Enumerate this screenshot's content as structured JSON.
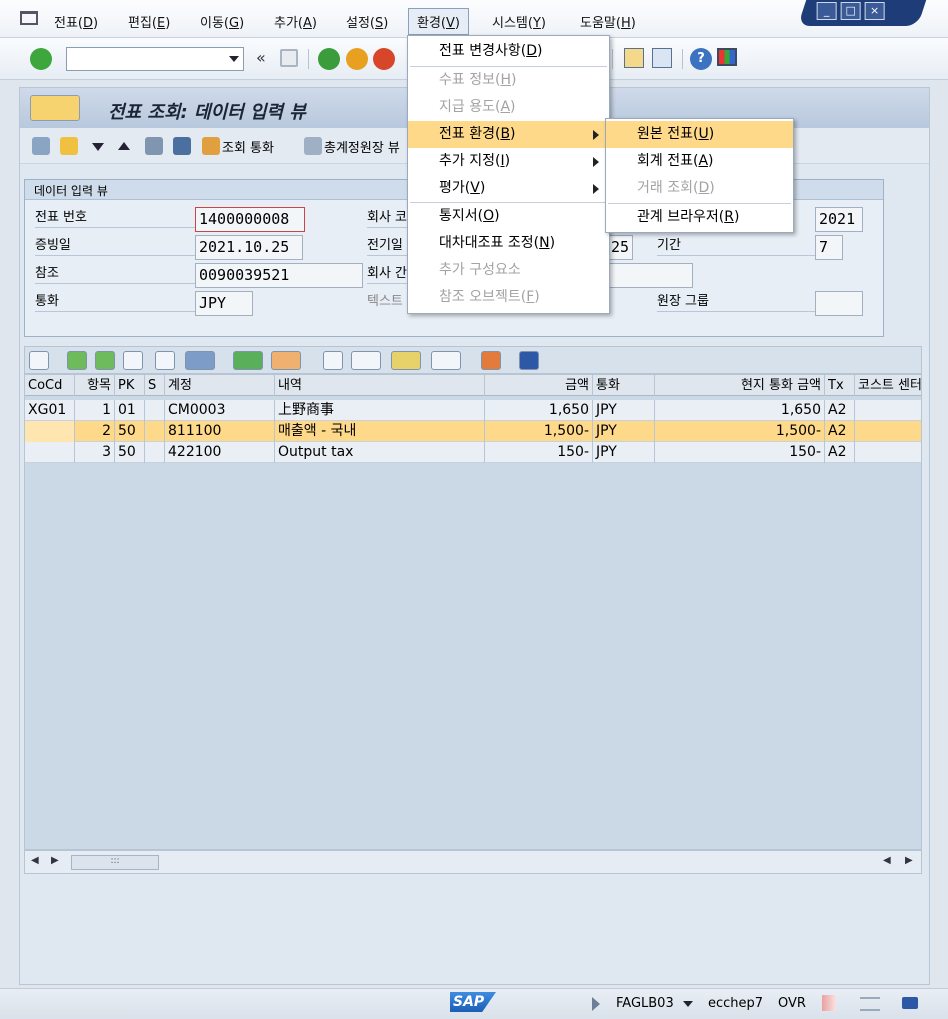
{
  "menubar": {
    "items": [
      {
        "label": "전표(",
        "key": "D",
        "end": ")"
      },
      {
        "label": "편집(",
        "key": "E",
        "end": ")"
      },
      {
        "label": "이동(",
        "key": "G",
        "end": ")"
      },
      {
        "label": "추가(",
        "key": "A",
        "end": ")"
      },
      {
        "label": "설정(",
        "key": "S",
        "end": ")"
      },
      {
        "label": "환경(",
        "key": "V",
        "end": ")"
      },
      {
        "label": "시스템(",
        "key": "Y",
        "end": ")"
      },
      {
        "label": "도움말(",
        "key": "H",
        "end": ")"
      }
    ]
  },
  "toolbar": {
    "command_value": "",
    "back_glyph": "«"
  },
  "screen": {
    "title": "전표 조회: 데이터 입력 뷰",
    "app_toolbar": {
      "display_currency": "조회 통화",
      "general_ledger": "총계정원장 뷰"
    }
  },
  "header": {
    "group_title": "데이터 입력 뷰",
    "doc_number_label": "전표 번호",
    "doc_number": "1400000008",
    "doc_date_label": "증빙일",
    "doc_date": "2021.10.25",
    "reference_label": "참조",
    "reference": "0090039521",
    "currency_label": "통화",
    "currency": "JPY",
    "company_label": "회사 코",
    "posting_date_label": "전기일",
    "posting_date_tail": "25",
    "intercompany_label": "회사 간",
    "text_label": "텍스트",
    "fiscal_year": "2021",
    "period_label": "기간",
    "period": "7",
    "ledger_group_label": "원장 그룹",
    "ledger_group": ""
  },
  "table": {
    "columns": [
      "CoCd",
      "항목",
      "PK",
      "S",
      "계정",
      "내역",
      "금액",
      "통화",
      "현지 통화 금액",
      "Tx",
      "코스트 센터"
    ],
    "rows": [
      {
        "cocd": "XG01",
        "item": "1",
        "pk": "01",
        "s": "",
        "account": "CM0003",
        "desc": "上野商事",
        "amount": "1,650",
        "curr": "JPY",
        "local": "1,650",
        "tx": "A2",
        "cc": ""
      },
      {
        "cocd": "",
        "item": "2",
        "pk": "50",
        "s": "",
        "account": "811100",
        "desc": "매출액 - 국내",
        "amount": "1,500-",
        "curr": "JPY",
        "local": "1,500-",
        "tx": "A2",
        "cc": ""
      },
      {
        "cocd": "",
        "item": "3",
        "pk": "50",
        "s": "",
        "account": "422100",
        "desc": "Output tax",
        "amount": "150-",
        "curr": "JPY",
        "local": "150-",
        "tx": "A2",
        "cc": ""
      }
    ],
    "scroll_thumb": ":::"
  },
  "env_menu": {
    "items": [
      {
        "label": "전표 변경사항(",
        "key": "D",
        "end": ")",
        "enabled": true
      },
      {
        "label": "수표 정보(",
        "key": "H",
        "end": ")",
        "enabled": false
      },
      {
        "label": "지급 용도(",
        "key": "A",
        "end": ")",
        "enabled": false
      },
      {
        "label": "전표 환경(",
        "key": "B",
        "end": ")",
        "enabled": true,
        "submenu": true,
        "highlighted": true
      },
      {
        "label": "추가 지정(",
        "key": "I",
        "end": ")",
        "enabled": true,
        "submenu": true
      },
      {
        "label": "평가(",
        "key": "V",
        "end": ")",
        "enabled": true,
        "submenu": true
      },
      {
        "label": "통지서(",
        "key": "O",
        "end": ")",
        "enabled": true
      },
      {
        "label": "대차대조표 조정(",
        "key": "N",
        "end": ")",
        "enabled": true
      },
      {
        "label": "추가 구성요소",
        "key": "",
        "end": "",
        "enabled": false
      },
      {
        "label": "참조 오브젝트(",
        "key": "F",
        "end": ")",
        "enabled": false
      }
    ]
  },
  "doc_env_submenu": {
    "items": [
      {
        "label": "원본 전표(",
        "key": "U",
        "end": ")",
        "enabled": true,
        "highlighted": true
      },
      {
        "label": "회계 전표(",
        "key": "A",
        "end": ")",
        "enabled": true
      },
      {
        "label": "거래 조회(",
        "key": "D",
        "end": ")",
        "enabled": false
      },
      {
        "label": "관계 브라우저(",
        "key": "R",
        "end": ")",
        "enabled": true
      }
    ]
  },
  "status": {
    "logo": "SAP",
    "transaction": "FAGLB03",
    "server": "ecchep7",
    "mode": "OVR"
  },
  "colors": {
    "highlight": "#ffd98a",
    "title_bar": "#b8c8dd",
    "field_border_focus": "#cc4444"
  }
}
